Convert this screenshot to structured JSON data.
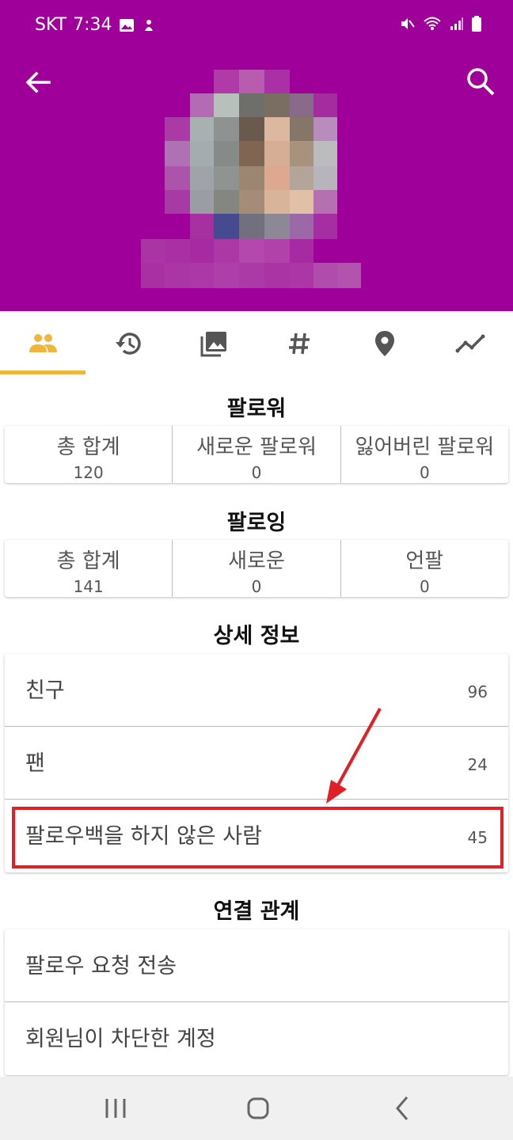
{
  "statusbar": {
    "carrier": "SKT",
    "time": "7:34"
  },
  "header": {
    "bg_color": "#a0009a",
    "back_icon": "back-arrow-icon",
    "search_icon": "search-icon"
  },
  "tabs": [
    {
      "icon": "people-icon",
      "active": true
    },
    {
      "icon": "history-icon",
      "active": false
    },
    {
      "icon": "photo-library-icon",
      "active": false
    },
    {
      "icon": "hashtag-icon",
      "active": false
    },
    {
      "icon": "location-pin-icon",
      "active": false
    },
    {
      "icon": "trend-line-icon",
      "active": false
    }
  ],
  "accent_color": "#f0b63b",
  "followers": {
    "title": "팔로워",
    "stats": [
      {
        "label": "총 합계",
        "value": "120"
      },
      {
        "label": "새로운 팔로워",
        "value": "0"
      },
      {
        "label": "잃어버린 팔로워",
        "value": "0"
      }
    ]
  },
  "following": {
    "title": "팔로잉",
    "stats": [
      {
        "label": "총 합계",
        "value": "141"
      },
      {
        "label": "새로운",
        "value": "0"
      },
      {
        "label": "언팔",
        "value": "0"
      }
    ]
  },
  "details": {
    "title": "상세 정보",
    "items": [
      {
        "label": "친구",
        "value": "96"
      },
      {
        "label": "팬",
        "value": "24"
      },
      {
        "label": "팔로우백을 하지 않은 사람",
        "value": "45"
      }
    ]
  },
  "relations": {
    "title": "연결 관계",
    "items": [
      {
        "label": "팔로우 요청 전송"
      },
      {
        "label": "회원님이 차단한 계정"
      }
    ]
  },
  "annotation_color": "#e01f27",
  "navbar": {
    "icons": [
      "recent-apps-icon",
      "home-icon",
      "nav-back-icon"
    ]
  }
}
